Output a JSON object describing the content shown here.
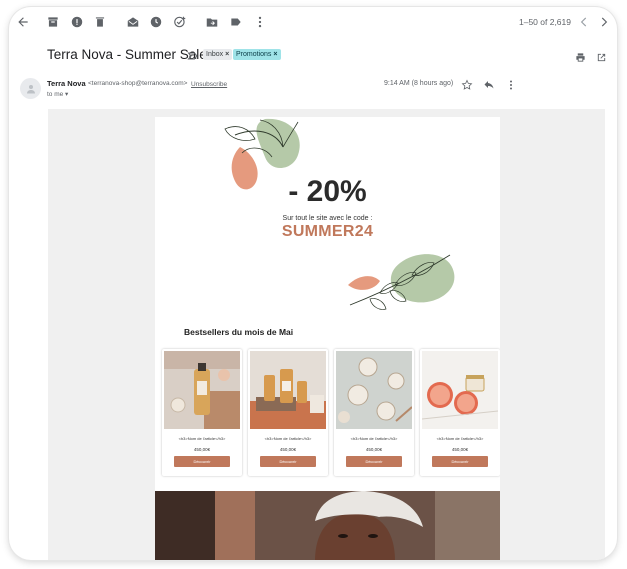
{
  "toolbar": {
    "pager": "1–50 of 2,619",
    "icons": [
      "back-arrow-icon",
      "archive-icon",
      "report-spam-icon",
      "delete-icon",
      "mark-unread-icon",
      "snooze-icon",
      "add-task-icon",
      "move-to-icon",
      "label-icon",
      "more-vert-icon",
      "chevron-left-icon",
      "chevron-right-icon"
    ]
  },
  "message": {
    "subject": "Terra Nova - Summer Sale",
    "labels": [
      {
        "name": "Inbox",
        "remove": "×"
      },
      {
        "name": "Promotions",
        "remove": "×"
      }
    ],
    "sender_name": "Terra Nova",
    "sender_email": "<terranova-shop@terranova.com>",
    "unsubscribe": "Unsubscribe",
    "recipient": "to me ▾",
    "time": "9:14 AM (8 hours ago)"
  },
  "email": {
    "discount": "- 20%",
    "code_caption": "Sur tout le site avec le code :",
    "code": "SUMMER24",
    "bestsellers_title": "Bestsellers du mois de Mai",
    "products": [
      {
        "name": "<h3>Nom de l'article</h3>",
        "price": "450,00€",
        "button": "Découvrir"
      },
      {
        "name": "<h3>Nom de l'article</h3>",
        "price": "450,00€",
        "button": "Découvrir"
      },
      {
        "name": "<h3>Nom de l'article</h3>",
        "price": "450,00€",
        "button": "Découvrir"
      },
      {
        "name": "<h3>Nom de l'article</h3>",
        "price": "450,00€",
        "button": "Découvrir"
      }
    ]
  },
  "colors": {
    "accent": "#c0785b",
    "promo_chip": "#9fe3e8",
    "leaf": "#b5c9a8"
  }
}
